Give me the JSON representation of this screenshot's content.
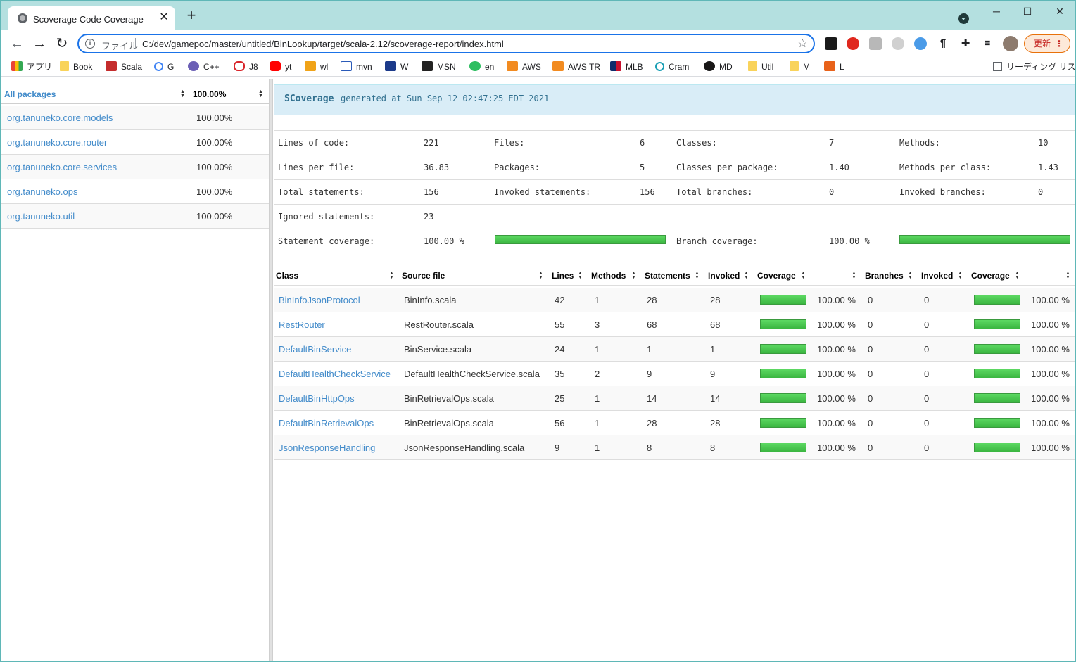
{
  "browser": {
    "tab_title": "Scoverage Code Coverage",
    "tab_close": "✕",
    "new_tab": "+",
    "window_controls": {
      "minimize": "─",
      "maximize": "☐",
      "close": "✕"
    },
    "nav": {
      "back": "←",
      "forward": "→",
      "reload": "↻"
    },
    "address": {
      "info": "i",
      "scheme": "ファイル",
      "url": "C:/dev/gamepoc/master/untitled/BinLookup/target/scala-2.12/scoverage-report/index.html",
      "star": "☆"
    },
    "update_label": "更新",
    "update_menu": "⋮",
    "bookmarks": [
      "アプリ",
      "Book",
      "Scala",
      "G",
      "C++",
      "J8",
      "yt",
      "wl",
      "mvn",
      "W",
      "MSN",
      "en",
      "AWS",
      "AWS TR",
      "MLB",
      "Cram",
      "MD",
      "Util",
      "M",
      "L"
    ],
    "reading_list": "リーディング リスト"
  },
  "packages": {
    "header_label": "All packages",
    "header_value": "100.00%",
    "rows": [
      {
        "name": "org.tanuneko.core.models",
        "coverage": "100.00%"
      },
      {
        "name": "org.tanuneko.core.router",
        "coverage": "100.00%"
      },
      {
        "name": "org.tanuneko.core.services",
        "coverage": "100.00%"
      },
      {
        "name": "org.tanuneko.ops",
        "coverage": "100.00%"
      },
      {
        "name": "org.tanuneko.util",
        "coverage": "100.00%"
      }
    ]
  },
  "report": {
    "brand": "SCoverage",
    "generated": "generated at Sun Sep 12 02:47:25 EDT 2021",
    "stats": {
      "lines_of_code_label": "Lines of code:",
      "lines_of_code": "221",
      "files_label": "Files:",
      "files": "6",
      "classes_label": "Classes:",
      "classes": "7",
      "methods_label": "Methods:",
      "methods": "10",
      "lines_per_file_label": "Lines per file:",
      "lines_per_file": "36.83",
      "packages_label": "Packages:",
      "packages": "5",
      "classes_per_package_label": "Classes per package:",
      "classes_per_package": "1.40",
      "methods_per_class_label": "Methods per class:",
      "methods_per_class": "1.43",
      "total_statements_label": "Total statements:",
      "total_statements": "156",
      "invoked_statements_label": "Invoked statements:",
      "invoked_statements": "156",
      "total_branches_label": "Total branches:",
      "total_branches": "0",
      "invoked_branches_label": "Invoked branches:",
      "invoked_branches": "0",
      "ignored_statements_label": "Ignored statements:",
      "ignored_statements": "23",
      "statement_coverage_label": "Statement coverage:",
      "statement_coverage": "100.00 %",
      "branch_coverage_label": "Branch coverage:",
      "branch_coverage": "100.00 %",
      "statement_coverage_fraction": 1.0,
      "branch_coverage_fraction": 1.0
    },
    "table": {
      "headers": {
        "class": "Class",
        "source": "Source file",
        "lines": "Lines",
        "methods": "Methods",
        "statements": "Statements",
        "invoked": "Invoked",
        "coverage": "Coverage",
        "branches": "Branches",
        "invoked_b": "Invoked",
        "coverage_b": "Coverage"
      },
      "rows": [
        {
          "class": "BinInfoJsonProtocol",
          "source": "BinInfo.scala",
          "lines": "42",
          "methods": "1",
          "statements": "28",
          "invoked": "28",
          "coverage": "100.00 %",
          "branches": "0",
          "invoked_b": "0",
          "coverage_b": "100.00 %"
        },
        {
          "class": "RestRouter",
          "source": "RestRouter.scala",
          "lines": "55",
          "methods": "3",
          "statements": "68",
          "invoked": "68",
          "coverage": "100.00 %",
          "branches": "0",
          "invoked_b": "0",
          "coverage_b": "100.00 %"
        },
        {
          "class": "DefaultBinService",
          "source": "BinService.scala",
          "lines": "24",
          "methods": "1",
          "statements": "1",
          "invoked": "1",
          "coverage": "100.00 %",
          "branches": "0",
          "invoked_b": "0",
          "coverage_b": "100.00 %"
        },
        {
          "class": "DefaultHealthCheckService",
          "source": "DefaultHealthCheckService.scala",
          "lines": "35",
          "methods": "2",
          "statements": "9",
          "invoked": "9",
          "coverage": "100.00 %",
          "branches": "0",
          "invoked_b": "0",
          "coverage_b": "100.00 %"
        },
        {
          "class": "DefaultBinHttpOps",
          "source": "BinRetrievalOps.scala",
          "lines": "25",
          "methods": "1",
          "statements": "14",
          "invoked": "14",
          "coverage": "100.00 %",
          "branches": "0",
          "invoked_b": "0",
          "coverage_b": "100.00 %"
        },
        {
          "class": "DefaultBinRetrievalOps",
          "source": "BinRetrievalOps.scala",
          "lines": "56",
          "methods": "1",
          "statements": "28",
          "invoked": "28",
          "coverage": "100.00 %",
          "branches": "0",
          "invoked_b": "0",
          "coverage_b": "100.00 %"
        },
        {
          "class": "JsonResponseHandling",
          "source": "JsonResponseHandling.scala",
          "lines": "9",
          "methods": "1",
          "statements": "8",
          "invoked": "8",
          "coverage": "100.00 %",
          "branches": "0",
          "invoked_b": "0",
          "coverage_b": "100.00 %"
        }
      ]
    }
  },
  "colors": {
    "link": "#428bca",
    "bar_green": "#44c54a",
    "header_bg": "#d9edf7",
    "accent": "#1a73e8"
  }
}
